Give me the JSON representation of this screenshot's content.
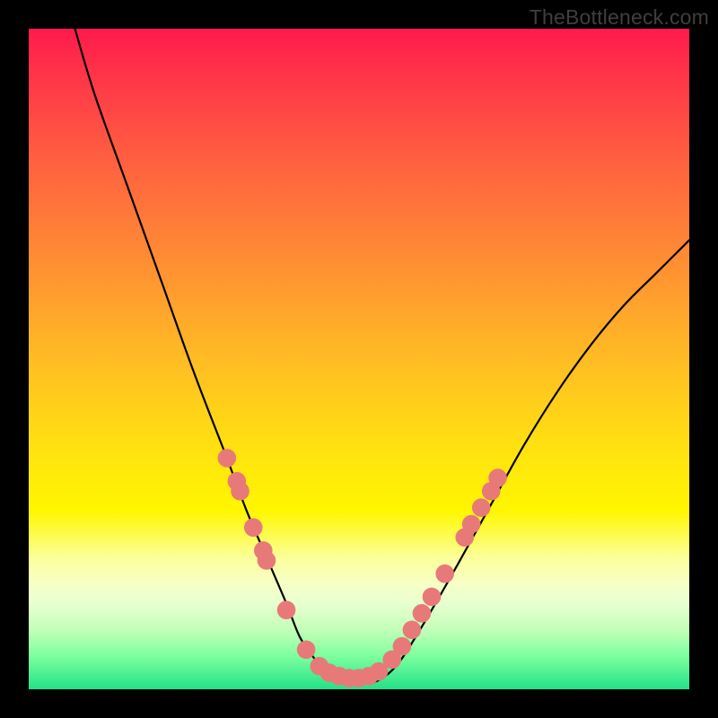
{
  "watermark": "TheBottleneck.com",
  "chart_data": {
    "type": "line",
    "title": "",
    "xlabel": "",
    "ylabel": "",
    "xlim": [
      0,
      100
    ],
    "ylim": [
      0,
      100
    ],
    "grid": false,
    "legend": false,
    "annotations": [],
    "series": [
      {
        "name": "bottleneck-curve",
        "x": [
          7,
          10,
          15,
          20,
          25,
          30,
          33,
          36,
          39,
          41,
          43,
          44.5,
          46,
          48,
          50,
          52,
          54,
          56,
          58,
          61,
          65,
          70,
          75,
          80,
          85,
          90,
          95,
          100
        ],
        "y": [
          100,
          90,
          76,
          62,
          48,
          35,
          27,
          20,
          13,
          8,
          5,
          3,
          2,
          1,
          1,
          1,
          2,
          4,
          7,
          12,
          19,
          28,
          37,
          45,
          52,
          58,
          63,
          68
        ]
      }
    ],
    "markers": [
      {
        "x": 30.0,
        "y_pct": 65.0
      },
      {
        "x": 31.5,
        "y_pct": 68.5
      },
      {
        "x": 32.0,
        "y_pct": 70.0
      },
      {
        "x": 34.0,
        "y_pct": 75.5
      },
      {
        "x": 35.5,
        "y_pct": 79.0
      },
      {
        "x": 36.0,
        "y_pct": 80.5
      },
      {
        "x": 39.0,
        "y_pct": 88.0
      },
      {
        "x": 42.0,
        "y_pct": 94.0
      },
      {
        "x": 44.0,
        "y_pct": 96.5
      },
      {
        "x": 45.5,
        "y_pct": 97.5
      },
      {
        "x": 47.0,
        "y_pct": 98.0
      },
      {
        "x": 48.5,
        "y_pct": 98.3
      },
      {
        "x": 50.0,
        "y_pct": 98.3
      },
      {
        "x": 51.5,
        "y_pct": 98.0
      },
      {
        "x": 53.0,
        "y_pct": 97.3
      },
      {
        "x": 55.0,
        "y_pct": 95.5
      },
      {
        "x": 56.5,
        "y_pct": 93.5
      },
      {
        "x": 58.0,
        "y_pct": 91.0
      },
      {
        "x": 59.5,
        "y_pct": 88.5
      },
      {
        "x": 61.0,
        "y_pct": 86.0
      },
      {
        "x": 63.0,
        "y_pct": 82.5
      },
      {
        "x": 66.0,
        "y_pct": 77.0
      },
      {
        "x": 67.0,
        "y_pct": 75.0
      },
      {
        "x": 68.5,
        "y_pct": 72.5
      },
      {
        "x": 70.0,
        "y_pct": 70.0
      },
      {
        "x": 71.0,
        "y_pct": 68.0
      }
    ],
    "marker_radius_pct": 1.4,
    "colors": {
      "curve": "#000000",
      "markers": "#e77a78",
      "gradient_top": "#ff1a4d",
      "gradient_bottom": "#22e188"
    }
  }
}
